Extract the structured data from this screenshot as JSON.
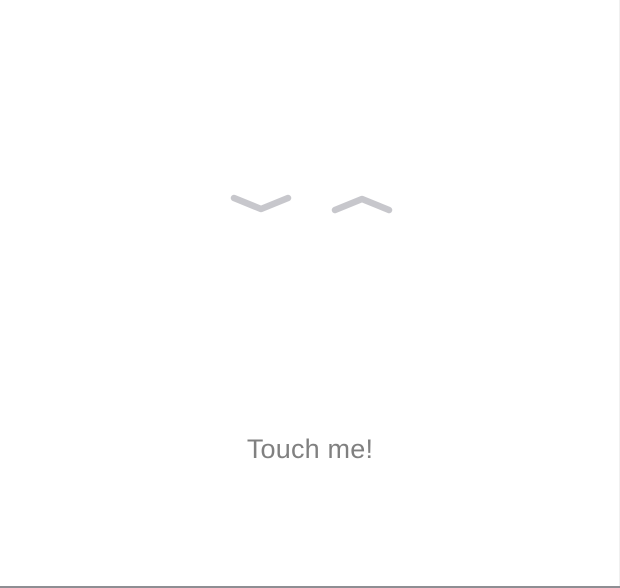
{
  "touch_area": {
    "label": "Touch me!"
  },
  "indicators": {
    "left_icon": "chevron-down-icon",
    "right_icon": "chevron-up-icon",
    "color": "#c7c7cc"
  },
  "colors": {
    "background": "#ffffff",
    "label": "#808080",
    "bottom_border": "#8e8e93"
  }
}
